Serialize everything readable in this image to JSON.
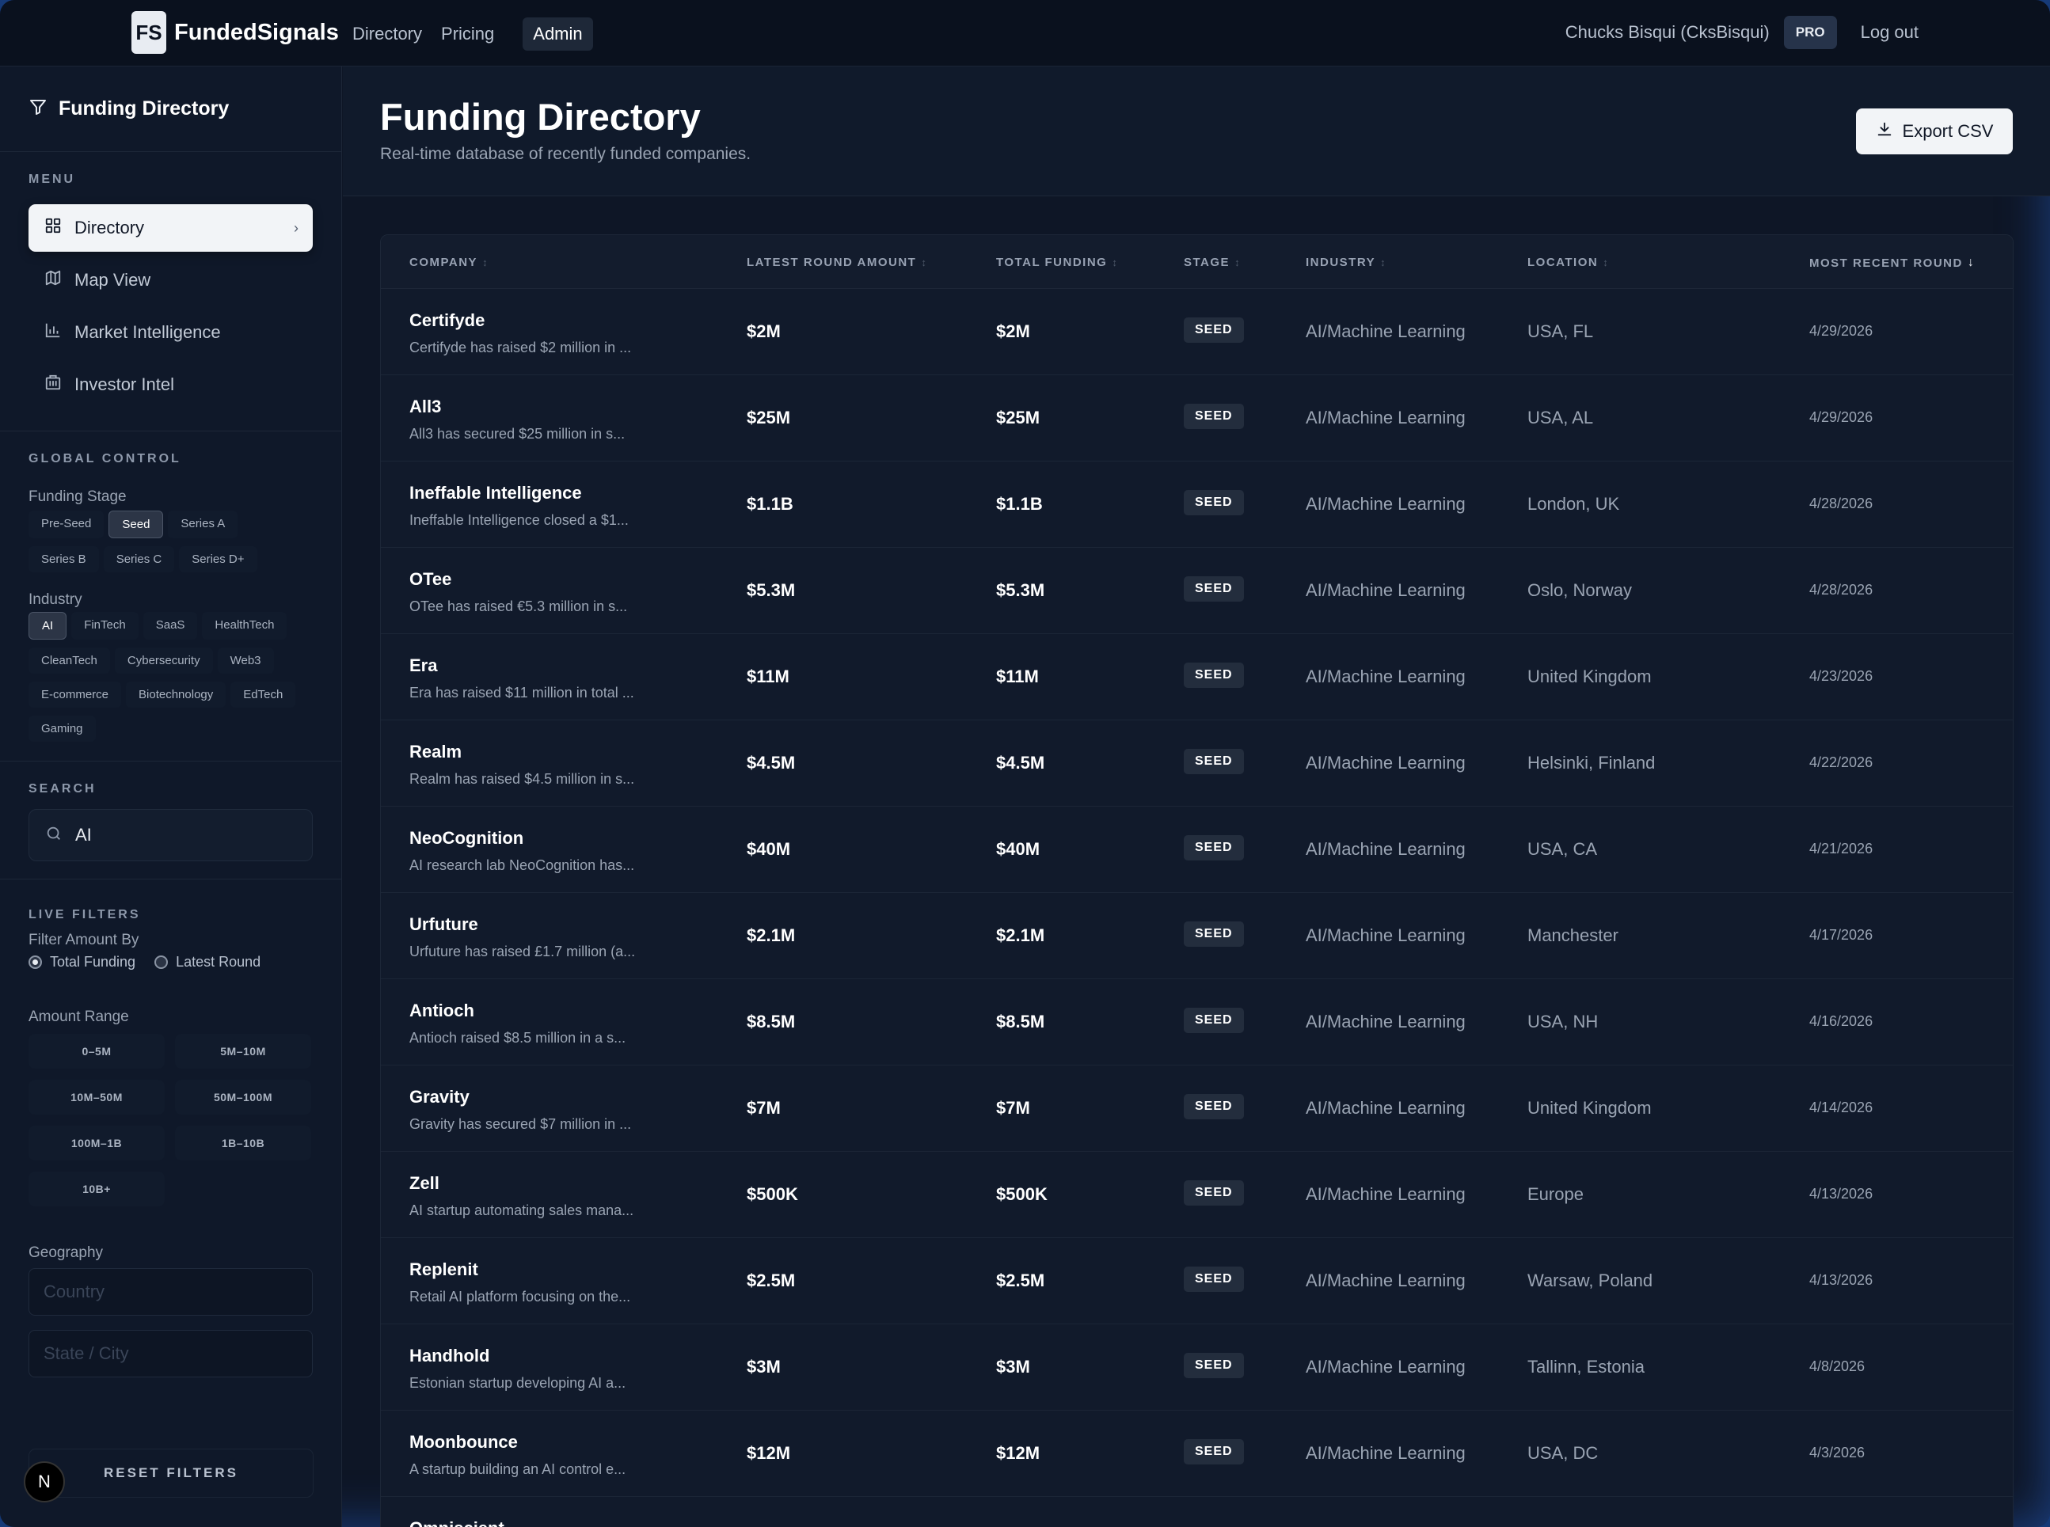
{
  "topnav": {
    "logo_badge": "FS",
    "logo_text": "FundedSignals",
    "links": [
      "Directory",
      "Pricing",
      "Admin"
    ],
    "user": "Chucks Bisqui (CksBisqui)",
    "plan_badge": "PRO",
    "logout": "Log out"
  },
  "sidebar": {
    "title": "Funding Directory",
    "menu_label": "MENU",
    "menu": [
      {
        "label": "Directory",
        "icon": "grid-icon",
        "active": true
      },
      {
        "label": "Map View",
        "icon": "map-icon",
        "active": false
      },
      {
        "label": "Market Intelligence",
        "icon": "bar-chart-icon",
        "active": false
      },
      {
        "label": "Investor Intel",
        "icon": "building-icon",
        "active": false
      }
    ],
    "global_label": "GLOBAL CONTROL",
    "funding_stage_label": "Funding Stage",
    "funding_stages": [
      "Pre-Seed",
      "Seed",
      "Series A",
      "Series B",
      "Series C",
      "Series D+"
    ],
    "funding_stage_selected": "Seed",
    "industry_label": "Industry",
    "industries": [
      "AI",
      "FinTech",
      "SaaS",
      "HealthTech",
      "CleanTech",
      "Cybersecurity",
      "Web3",
      "E-commerce",
      "Biotechnology",
      "EdTech",
      "Gaming"
    ],
    "industry_selected": "AI",
    "search_label": "SEARCH",
    "search_value": "AI",
    "live_filters_label": "LIVE FILTERS",
    "filter_amount_label": "Filter Amount By",
    "filter_amount_options": [
      "Total Funding",
      "Latest Round"
    ],
    "filter_amount_selected": "Total Funding",
    "amount_range_label": "Amount Range",
    "amount_ranges": [
      "0–5M",
      "5M–10M",
      "10M–50M",
      "50M–100M",
      "100M–1B",
      "1B–10B",
      "10B+"
    ],
    "geography_label": "Geography",
    "country_placeholder": "Country",
    "state_placeholder": "State / City",
    "reset_label": "RESET FILTERS",
    "n_badge": "N"
  },
  "main": {
    "title": "Funding Directory",
    "subtitle": "Real-time database of recently funded companies.",
    "export_label": "Export CSV",
    "columns": [
      "COMPANY",
      "LATEST ROUND AMOUNT",
      "TOTAL FUNDING",
      "STAGE",
      "INDUSTRY",
      "LOCATION",
      "MOST RECENT ROUND"
    ],
    "sorted_column": "MOST RECENT ROUND",
    "rows": [
      {
        "name": "Certifyde",
        "desc": "Certifyde has raised $2 million in ...",
        "latest": "$2M",
        "total": "$2M",
        "stage": "SEED",
        "industry": "AI/Machine Learning",
        "location": "USA, FL",
        "date": "4/29/2026"
      },
      {
        "name": "All3",
        "desc": "All3 has secured $25 million in s...",
        "latest": "$25M",
        "total": "$25M",
        "stage": "SEED",
        "industry": "AI/Machine Learning",
        "location": "USA, AL",
        "date": "4/29/2026"
      },
      {
        "name": "Ineffable Intelligence",
        "desc": "Ineffable Intelligence closed a $1...",
        "latest": "$1.1B",
        "total": "$1.1B",
        "stage": "SEED",
        "industry": "AI/Machine Learning",
        "location": "London, UK",
        "date": "4/28/2026"
      },
      {
        "name": "OTee",
        "desc": "OTee has raised €5.3 million in s...",
        "latest": "$5.3M",
        "total": "$5.3M",
        "stage": "SEED",
        "industry": "AI/Machine Learning",
        "location": "Oslo, Norway",
        "date": "4/28/2026"
      },
      {
        "name": "Era",
        "desc": "Era has raised $11 million in total ...",
        "latest": "$11M",
        "total": "$11M",
        "stage": "SEED",
        "industry": "AI/Machine Learning",
        "location": "United Kingdom",
        "date": "4/23/2026"
      },
      {
        "name": "Realm",
        "desc": "Realm has raised $4.5 million in s...",
        "latest": "$4.5M",
        "total": "$4.5M",
        "stage": "SEED",
        "industry": "AI/Machine Learning",
        "location": "Helsinki, Finland",
        "date": "4/22/2026"
      },
      {
        "name": "NeoCognition",
        "desc": "AI research lab NeoCognition has...",
        "latest": "$40M",
        "total": "$40M",
        "stage": "SEED",
        "industry": "AI/Machine Learning",
        "location": "USA, CA",
        "date": "4/21/2026"
      },
      {
        "name": "Urfuture",
        "desc": "Urfuture has raised £1.7 million (a...",
        "latest": "$2.1M",
        "total": "$2.1M",
        "stage": "SEED",
        "industry": "AI/Machine Learning",
        "location": "Manchester",
        "date": "4/17/2026"
      },
      {
        "name": "Antioch",
        "desc": "Antioch raised $8.5 million in a s...",
        "latest": "$8.5M",
        "total": "$8.5M",
        "stage": "SEED",
        "industry": "AI/Machine Learning",
        "location": "USA, NH",
        "date": "4/16/2026"
      },
      {
        "name": "Gravity",
        "desc": "Gravity has secured $7 million in ...",
        "latest": "$7M",
        "total": "$7M",
        "stage": "SEED",
        "industry": "AI/Machine Learning",
        "location": "United Kingdom",
        "date": "4/14/2026"
      },
      {
        "name": "Zell",
        "desc": "AI startup automating sales mana...",
        "latest": "$500K",
        "total": "$500K",
        "stage": "SEED",
        "industry": "AI/Machine Learning",
        "location": "Europe",
        "date": "4/13/2026"
      },
      {
        "name": "Replenit",
        "desc": "Retail AI platform focusing on the...",
        "latest": "$2.5M",
        "total": "$2.5M",
        "stage": "SEED",
        "industry": "AI/Machine Learning",
        "location": "Warsaw, Poland",
        "date": "4/13/2026"
      },
      {
        "name": "Handhold",
        "desc": "Estonian startup developing AI a...",
        "latest": "$3M",
        "total": "$3M",
        "stage": "SEED",
        "industry": "AI/Machine Learning",
        "location": "Tallinn, Estonia",
        "date": "4/8/2026"
      },
      {
        "name": "Moonbounce",
        "desc": "A startup building an AI control e...",
        "latest": "$12M",
        "total": "$12M",
        "stage": "SEED",
        "industry": "AI/Machine Learning",
        "location": "USA, DC",
        "date": "4/3/2026"
      },
      {
        "name": "Omniscient",
        "desc": "",
        "latest": "",
        "total": "",
        "stage": "",
        "industry": "",
        "location": "",
        "date": ""
      }
    ]
  }
}
